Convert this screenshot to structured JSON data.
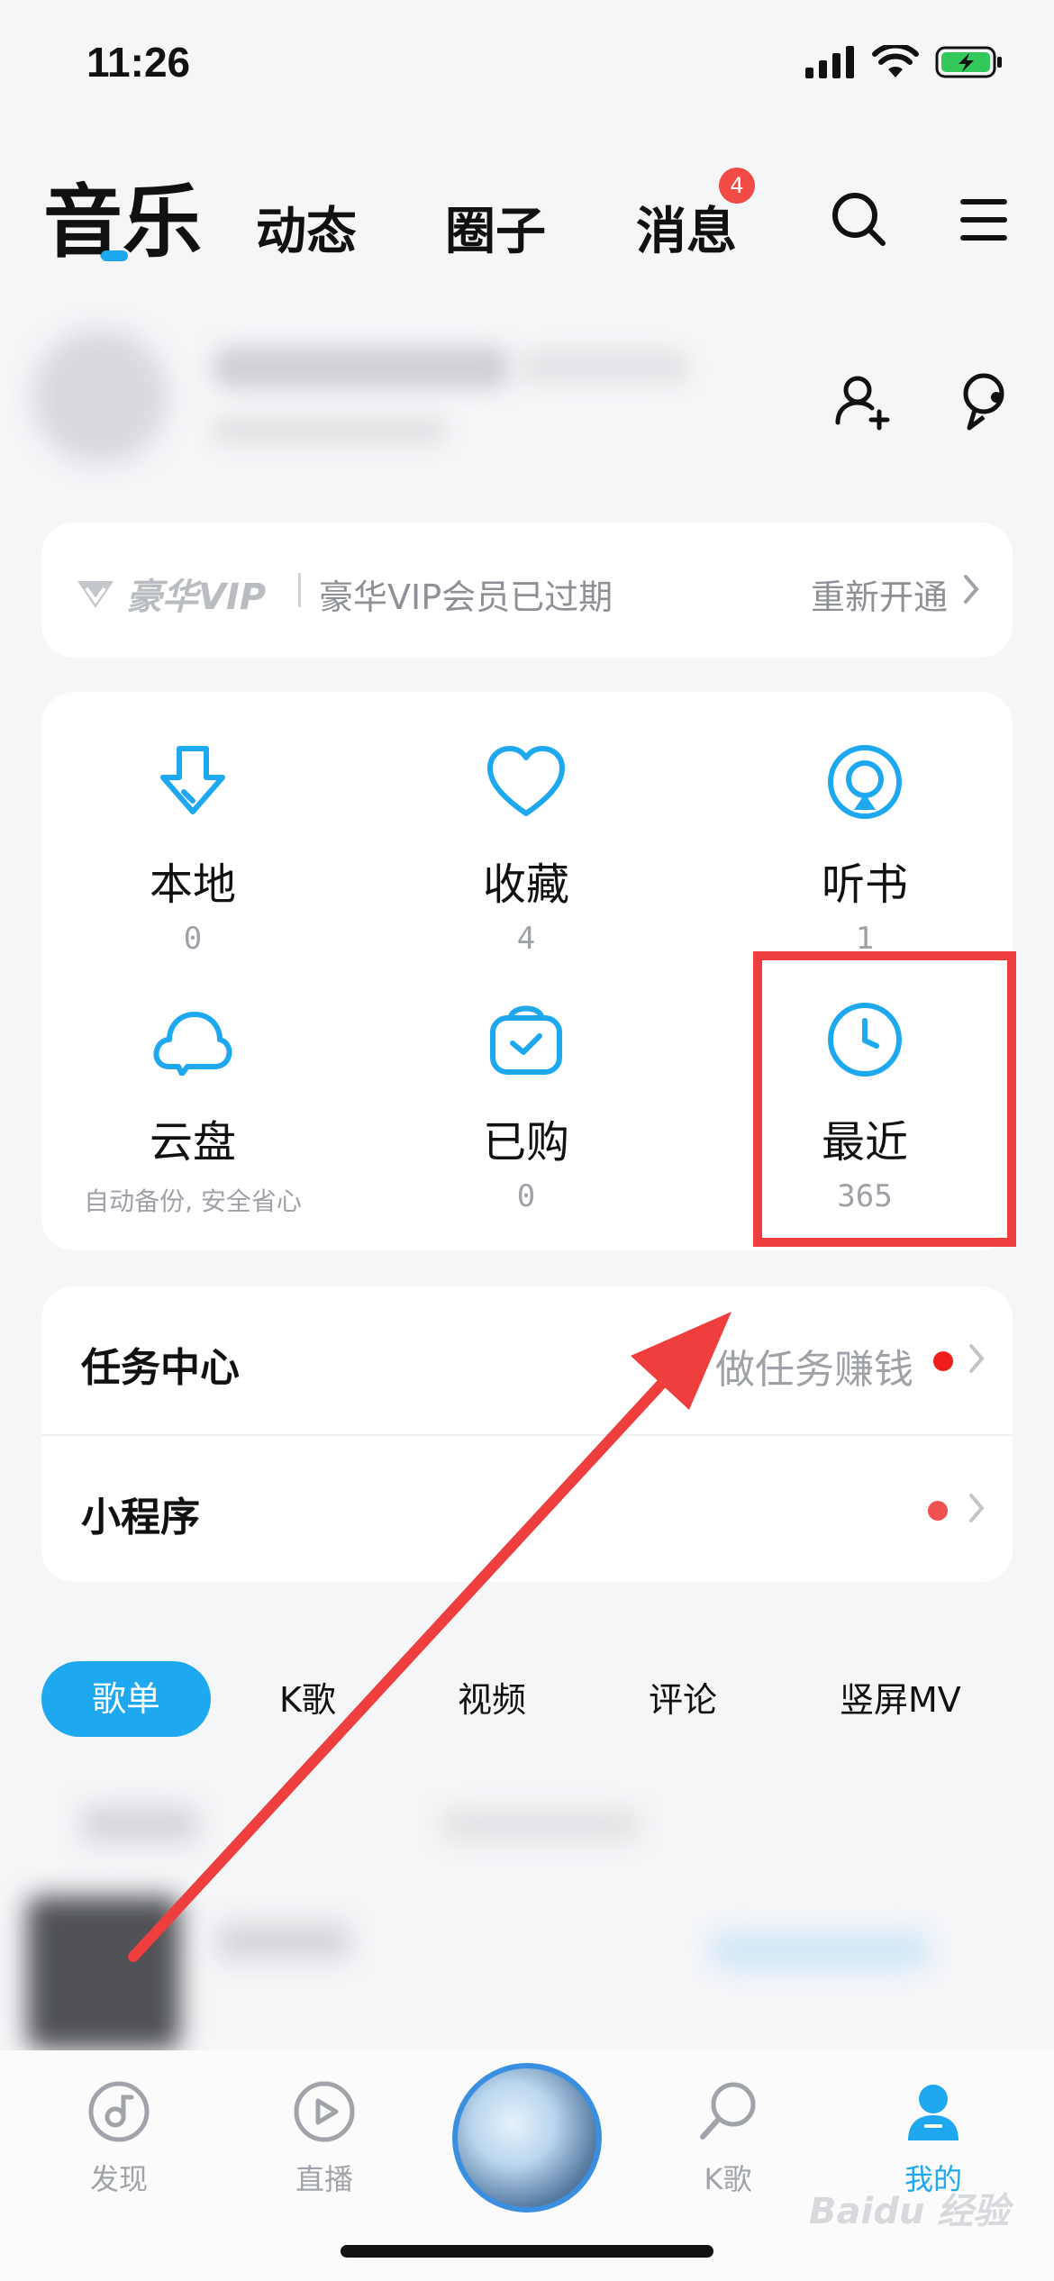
{
  "status_bar": {
    "time": "11:26"
  },
  "top_nav": {
    "tabs": [
      {
        "label": "音乐",
        "active": true
      },
      {
        "label": "动态"
      },
      {
        "label": "圈子"
      },
      {
        "label": "消息",
        "badge": "4"
      }
    ]
  },
  "vip": {
    "logo_text": "豪华VIP",
    "status_text": "豪华VIP会员已过期",
    "renew_label": "重新开通"
  },
  "grid": {
    "items": [
      {
        "label": "本地",
        "count": "0",
        "icon": "download-icon"
      },
      {
        "label": "收藏",
        "count": "4",
        "icon": "heart-icon"
      },
      {
        "label": "听书",
        "count": "1",
        "icon": "audiobook-icon"
      },
      {
        "label": "云盘",
        "sub": "自动备份, 安全省心",
        "icon": "cloud-icon"
      },
      {
        "label": "已购",
        "count": "0",
        "icon": "purchased-icon"
      },
      {
        "label": "最近",
        "count": "365",
        "icon": "clock-icon"
      }
    ]
  },
  "list": {
    "rows": [
      {
        "title": "任务中心",
        "right_text": "做任务赚钱"
      },
      {
        "title": "小程序",
        "right_text": ""
      }
    ]
  },
  "sub_tabs": [
    "歌单",
    "K歌",
    "视频",
    "评论",
    "竖屏MV"
  ],
  "bottom_nav": {
    "items": [
      {
        "label": "发现",
        "icon": "discover-icon"
      },
      {
        "label": "直播",
        "icon": "live-icon"
      },
      {
        "label": "K歌",
        "icon": "microphone-icon"
      },
      {
        "label": "我的",
        "icon": "profile-icon",
        "active": true
      }
    ]
  },
  "watermark": "Baidu 经验",
  "colors": {
    "accent": "#1ea8f0",
    "highlight": "#ef3e3e",
    "badge": "#f24a44"
  }
}
